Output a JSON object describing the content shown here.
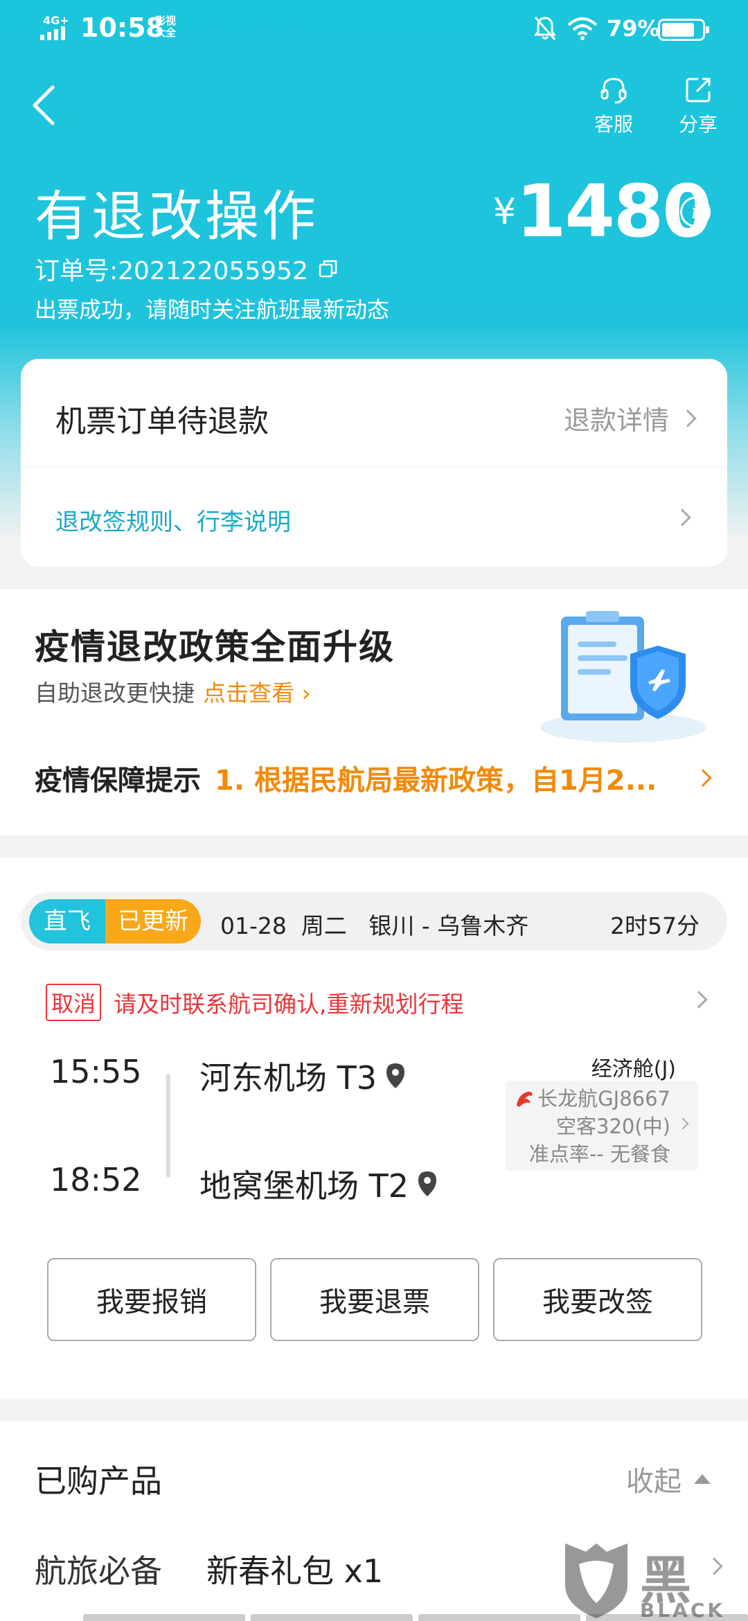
{
  "status_bar": {
    "network": "4G+",
    "time": "10:58",
    "app_badge": "影视\n大全",
    "battery_pct": "79%"
  },
  "header": {
    "service_label": "客服",
    "share_label": "分享",
    "title": "有退改操作",
    "currency": "¥",
    "price": "1480",
    "order_number": "订单号:202122055952",
    "status_message": "出票成功，请随时关注航班最新动态"
  },
  "refund_card": {
    "title": "机票订单待退款",
    "detail_link": "退款详情",
    "rules_link": "退改签规则、行李说明"
  },
  "policy": {
    "title": "疫情退改政策全面升级",
    "subtitle": "自助退改更快捷",
    "view_link": "点击查看 ›",
    "notice_label": "疫情保障提示",
    "notice_text": "1. 根据民航局最新政策，自1月2..."
  },
  "flight": {
    "tag_direct": "直飞",
    "tag_updated": "已更新",
    "route": "01-28  周二   银川 - 乌鲁木齐",
    "duration": "2时57分",
    "cancel_tag": "取消",
    "cancel_message": "请及时联系航司确认,重新规划行程",
    "dep_time": "15:55",
    "arr_time": "18:52",
    "dep_airport": "河东机场 T3",
    "arr_airport": "地窝堡机场 T2",
    "cabin": "经济舱(J)",
    "airline_flight": "长龙航GJ8667",
    "aircraft": "空客320(中)",
    "ontime_meal": "准点率-- 无餐食",
    "airline_color": "#e23a2d"
  },
  "actions": {
    "reimburse": "我要报销",
    "refund": "我要退票",
    "change": "我要改签"
  },
  "products": {
    "title": "已购产品",
    "collapse": "收起",
    "category": "航旅必备",
    "item": "新春礼包 x1"
  },
  "watermark": {
    "cn": "黑猫",
    "en": "BLACK CAT"
  },
  "colors": {
    "brand_teal": "#1bc5dc",
    "accent_orange": "#f18a0a",
    "alert_red": "#e9363b",
    "link_teal": "#1ba9c4"
  }
}
